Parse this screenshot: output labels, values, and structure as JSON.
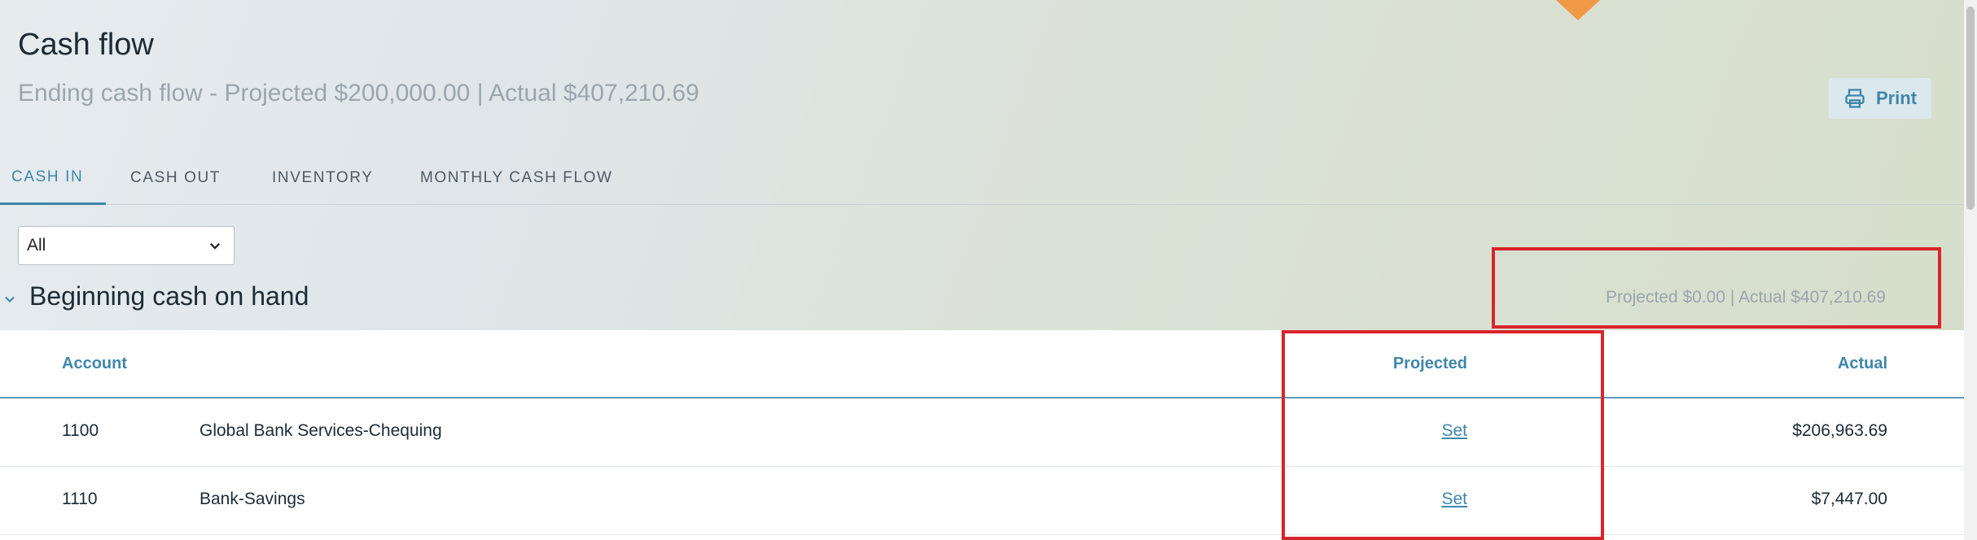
{
  "header": {
    "title": "Cash flow",
    "subtitle": "Ending cash flow - Projected $200,000.00 | Actual $407,210.69",
    "print_label": "Print"
  },
  "tabs": [
    {
      "label": "CASH IN",
      "active": true
    },
    {
      "label": "CASH OUT",
      "active": false
    },
    {
      "label": "INVENTORY",
      "active": false
    },
    {
      "label": "MONTHLY CASH FLOW",
      "active": false
    }
  ],
  "filter": {
    "selected": "All"
  },
  "section": {
    "title": "Beginning cash on hand",
    "summary": "Projected $0.00 | Actual $407,210.69"
  },
  "table": {
    "headers": {
      "account": "Account",
      "projected": "Projected",
      "actual": "Actual"
    },
    "rows": [
      {
        "code": "1100",
        "name": "Global Bank Services-Chequing",
        "projected": "Set",
        "actual": "$206,963.69"
      },
      {
        "code": "1110",
        "name": "Bank-Savings",
        "projected": "Set",
        "actual": "$7,447.00"
      }
    ]
  },
  "colors": {
    "accent": "#3f86aa",
    "highlight_border": "#d9242b"
  }
}
